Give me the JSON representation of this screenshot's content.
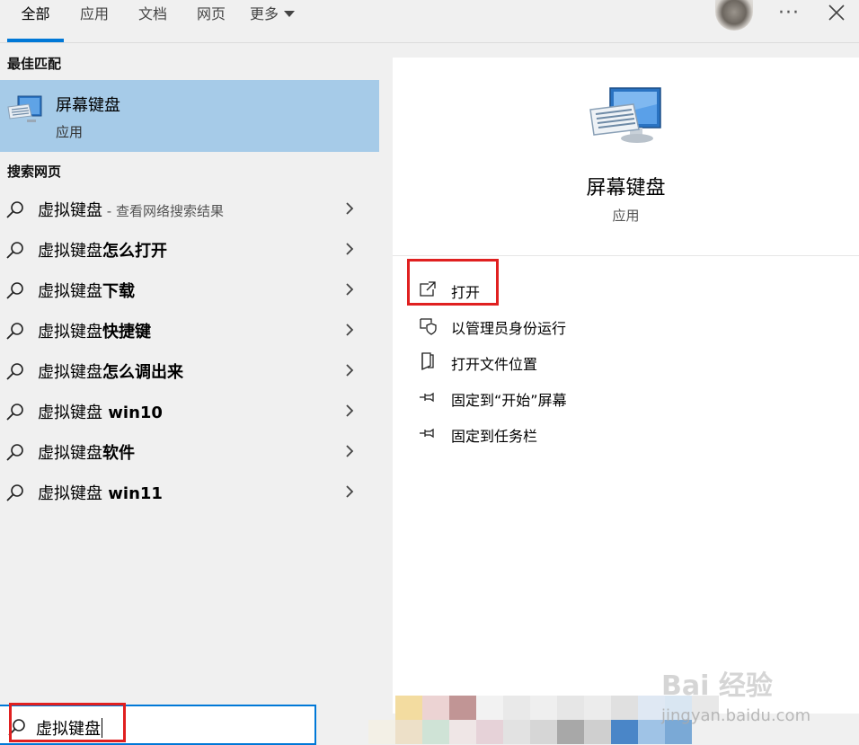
{
  "tabs": [
    {
      "label": "全部",
      "active": true
    },
    {
      "label": "应用",
      "active": false
    },
    {
      "label": "文档",
      "active": false
    },
    {
      "label": "网页",
      "active": false
    },
    {
      "label": "更多",
      "active": false
    }
  ],
  "header_icons": [
    "avatar",
    "more-icon",
    "close-icon"
  ],
  "more_glyph": "···",
  "best_match": {
    "heading": "最佳匹配",
    "title": "屏幕键盘",
    "subtitle": "应用",
    "icon": "keyboard-monitor-icon"
  },
  "web_search": {
    "heading": "搜索网页",
    "items": [
      {
        "prefix": "虚拟键盘",
        "bold": "",
        "hint": " - 查看网络搜索结果"
      },
      {
        "prefix": "虚拟键盘",
        "bold": "怎么打开",
        "hint": ""
      },
      {
        "prefix": "虚拟键盘",
        "bold": "下载",
        "hint": ""
      },
      {
        "prefix": "虚拟键盘",
        "bold": "快捷键",
        "hint": ""
      },
      {
        "prefix": "虚拟键盘",
        "bold": "怎么调出来",
        "hint": ""
      },
      {
        "prefix": "虚拟键盘",
        "bold": " win10",
        "hint": ""
      },
      {
        "prefix": "虚拟键盘",
        "bold": "软件",
        "hint": ""
      },
      {
        "prefix": "虚拟键盘",
        "bold": " win11",
        "hint": ""
      }
    ]
  },
  "detail": {
    "title": "屏幕键盘",
    "subtitle": "应用",
    "actions": [
      {
        "label": "打开",
        "icon": "open-icon",
        "highlighted": true
      },
      {
        "label": "以管理员身份运行",
        "icon": "shield-icon",
        "highlighted": false
      },
      {
        "label": "打开文件位置",
        "icon": "file-location-icon",
        "highlighted": false
      },
      {
        "label": "固定到“开始”屏幕",
        "icon": "pin-icon",
        "highlighted": false
      },
      {
        "label": "固定到任务栏",
        "icon": "pin-icon",
        "highlighted": false
      }
    ]
  },
  "search": {
    "query": "虚拟键盘"
  },
  "watermark": {
    "brand": "Bai 经验",
    "site": "jingyan.baidu.com"
  },
  "colors": {
    "accent": "#0078d7",
    "selected": "#a6cbe8",
    "highlight_box": "#e02020"
  }
}
